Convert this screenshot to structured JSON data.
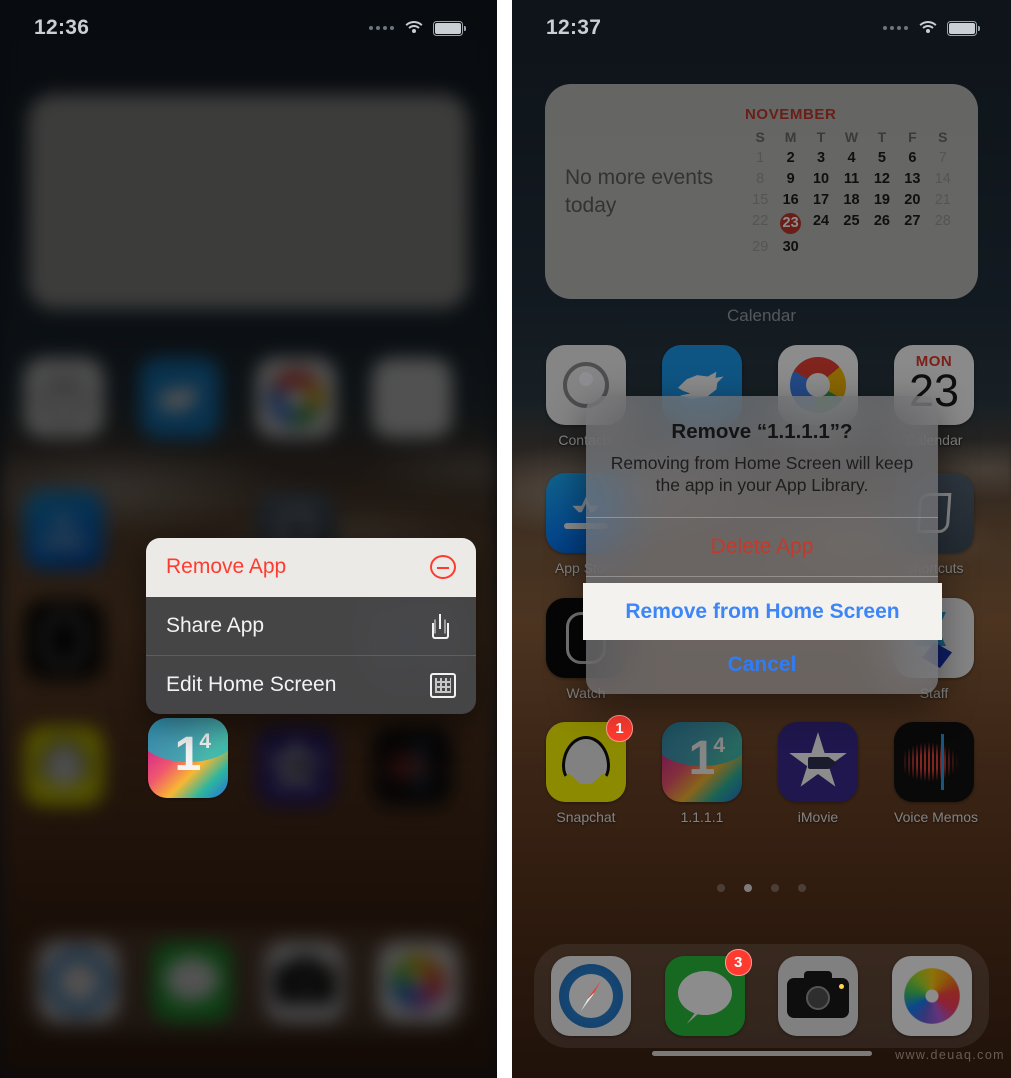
{
  "panels": {
    "left": {
      "status": {
        "time": "12:36",
        "wifi_icon": "wifi-icon",
        "battery_icon": "battery-icon",
        "signal_icon": "signal-dots-icon"
      },
      "context_menu": {
        "items": [
          {
            "label": "Remove App",
            "icon": "minus-circle-icon",
            "highlighted": true
          },
          {
            "label": "Share App",
            "icon": "share-icon",
            "highlighted": false
          },
          {
            "label": "Edit Home Screen",
            "icon": "edit-home-screen-icon",
            "highlighted": false
          }
        ]
      },
      "focused_app": {
        "label": "1.1.1.1",
        "icon": "cloudflare-1111-icon"
      }
    },
    "right": {
      "status": {
        "time": "12:37",
        "wifi_icon": "wifi-icon",
        "battery_icon": "battery-icon",
        "signal_icon": "signal-dots-icon"
      },
      "calendar_widget": {
        "no_events_text": "No more events today",
        "month": "NOVEMBER",
        "weekdays": [
          "S",
          "M",
          "T",
          "W",
          "T",
          "F",
          "S"
        ],
        "weeks": [
          [
            "1",
            "2",
            "3",
            "4",
            "5",
            "6",
            "7"
          ],
          [
            "8",
            "9",
            "10",
            "11",
            "12",
            "13",
            "14"
          ],
          [
            "15",
            "16",
            "17",
            "18",
            "19",
            "20",
            "21"
          ],
          [
            "22",
            "23",
            "24",
            "25",
            "26",
            "27",
            "28"
          ],
          [
            "29",
            "30",
            "",
            "",
            "",
            "",
            ""
          ]
        ],
        "today": "23",
        "widget_label": "Calendar"
      },
      "day_widget": {
        "weekday": "MON",
        "day": "23"
      },
      "app_row_top": [
        {
          "label": "Contacts",
          "icon": "contacts-icon"
        },
        {
          "label": "Twitter",
          "icon": "twitter-icon"
        },
        {
          "label": "Chrome",
          "icon": "chrome-icon"
        }
      ],
      "app_row_mid": [
        {
          "label": "App Store",
          "icon": "app-store-icon"
        },
        {
          "label": "Shortcuts",
          "icon": "shortcuts-icon"
        }
      ],
      "app_row_lower": [
        {
          "label": "Watch",
          "icon": "watch-icon"
        },
        {
          "label": "Staff",
          "icon": "staff-icon"
        }
      ],
      "app_row_bottom": [
        {
          "label": "Snapchat",
          "icon": "snapchat-icon",
          "badge": "1"
        },
        {
          "label": "1.1.1.1",
          "icon": "cloudflare-1111-icon",
          "badge": ""
        },
        {
          "label": "iMovie",
          "icon": "imovie-icon",
          "badge": ""
        },
        {
          "label": "Voice Memos",
          "icon": "voice-memos-icon",
          "badge": ""
        }
      ],
      "page_dots": {
        "count": 4,
        "active_index": 1
      },
      "dock": [
        {
          "label": "Safari",
          "icon": "safari-icon",
          "badge": ""
        },
        {
          "label": "Messages",
          "icon": "messages-icon",
          "badge": "3"
        },
        {
          "label": "Camera",
          "icon": "camera-icon",
          "badge": ""
        },
        {
          "label": "Photos",
          "icon": "photos-icon",
          "badge": ""
        }
      ],
      "alert": {
        "title": "Remove “1.1.1.1”?",
        "message": "Removing from Home Screen will keep the app in your App Library.",
        "delete_label": "Delete App",
        "remove_label": "Remove from Home Screen",
        "cancel_label": "Cancel"
      }
    }
  },
  "watermark": "www.deuaq.com",
  "colors": {
    "destructive_red": "#c23a2b",
    "menu_red": "#ff3b30",
    "action_blue": "#2f7cf6",
    "highlight_blue": "#3d86f7",
    "today_red": "#c0392b",
    "badge_red": "#ff3b30"
  }
}
